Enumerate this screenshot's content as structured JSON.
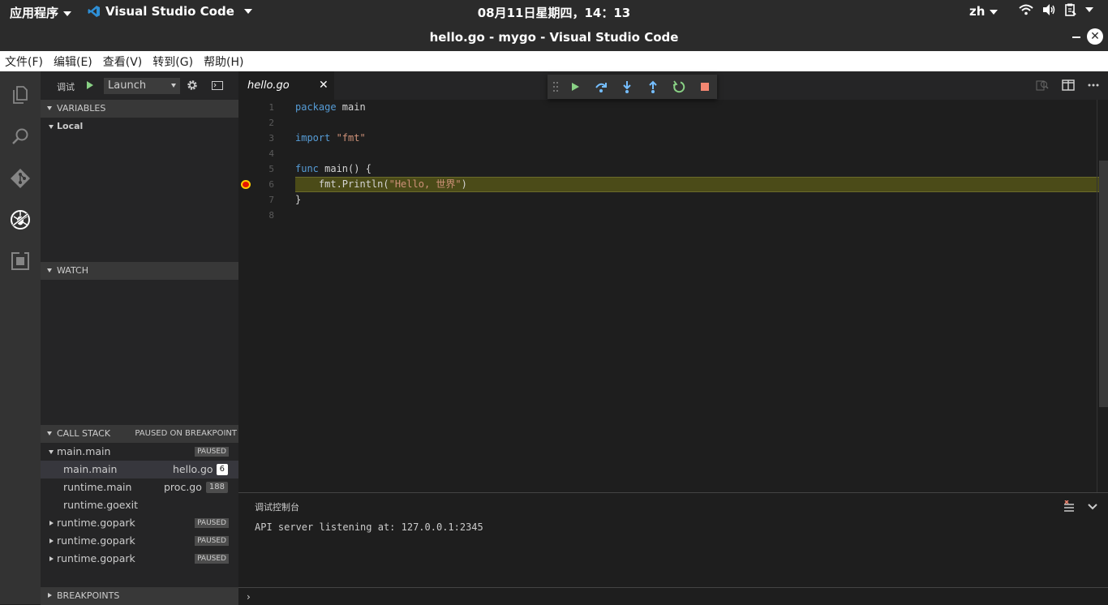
{
  "topbar": {
    "apps": "应用程序",
    "app_name": "Visual Studio Code",
    "clock": "08月11日星期四，14：13",
    "lang": "zh"
  },
  "window": {
    "title": "hello.go - mygo - Visual Studio Code"
  },
  "menu": [
    "文件(F)",
    "编辑(E)",
    "查看(V)",
    "转到(G)",
    "帮助(H)"
  ],
  "debug": {
    "label": "调试",
    "config": "Launch"
  },
  "variables": {
    "header": "VARIABLES",
    "scope": "Local"
  },
  "watch": {
    "header": "WATCH"
  },
  "callstack": {
    "header": "CALL STACK",
    "status": "PAUSED ON BREAKPOINT",
    "thread": {
      "name": "main.main",
      "badge": "PAUSED"
    },
    "frames": [
      {
        "name": "main.main",
        "file": "hello.go",
        "line": "6"
      },
      {
        "name": "runtime.main",
        "file": "proc.go",
        "line": "188"
      },
      {
        "name": "runtime.goexit",
        "file": "",
        "line": ""
      }
    ],
    "other_threads": [
      {
        "name": "runtime.gopark",
        "badge": "PAUSED"
      },
      {
        "name": "runtime.gopark",
        "badge": "PAUSED"
      },
      {
        "name": "runtime.gopark",
        "badge": "PAUSED"
      }
    ]
  },
  "breakpoints": {
    "header": "BREAKPOINTS"
  },
  "editor": {
    "tab": "hello.go",
    "line_numbers": [
      "1",
      "2",
      "3",
      "4",
      "5",
      "6",
      "7",
      "8"
    ],
    "code": {
      "l1_kw": "package",
      "l1_rest": " main",
      "l3_kw": "import",
      "l3_str": " \"fmt\"",
      "l5_kw": "func",
      "l5_rest": " main() {",
      "l6_pre": "    fmt.Println(",
      "l6_str": "\"Hello, 世界\"",
      "l6_post": ")",
      "l7": "}"
    }
  },
  "panel": {
    "title": "调试控制台",
    "output": "API server listening at: 127.0.0.1:2345"
  },
  "colors": {
    "accent_play": "#89d185",
    "stop": "#f48771",
    "debug_step": "#75beff",
    "highlight_line": "#4b4b18"
  }
}
